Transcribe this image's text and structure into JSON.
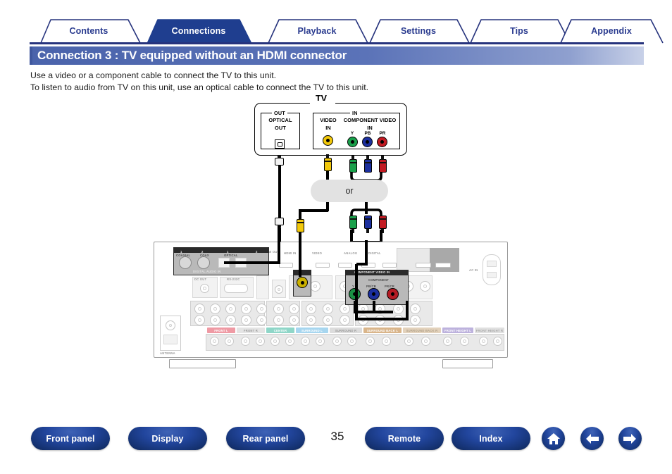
{
  "tabs": [
    {
      "label": "Contents",
      "active": false
    },
    {
      "label": "Connections",
      "active": true
    },
    {
      "label": "Playback",
      "active": false
    },
    {
      "label": "Settings",
      "active": false
    },
    {
      "label": "Tips",
      "active": false
    },
    {
      "label": "Appendix",
      "active": false
    }
  ],
  "page": {
    "title": "Connection 3 : TV equipped without an HDMI connector",
    "intro_line1": "Use a video or a component cable to connect the TV to this unit.",
    "intro_line2": "To listen to audio from TV on this unit, use an optical cable to connect the TV to this unit.",
    "number": "35"
  },
  "diagram": {
    "tv_label": "TV",
    "out_group": "OUT",
    "in_group": "IN",
    "optical_out": {
      "line1": "OPTICAL",
      "line2": "OUT"
    },
    "video_in": {
      "line1": "VIDEO",
      "line2": "IN"
    },
    "component_in": {
      "line1": "COMPONENT VIDEO",
      "line2": "IN"
    },
    "component_pins": [
      {
        "label": "Y",
        "color": "#18a04a"
      },
      {
        "label": "PB",
        "color": "#1b2f9e"
      },
      {
        "label": "PR",
        "color": "#c21a22"
      }
    ],
    "video_pin_color": "#f2c80a",
    "or_label": "or",
    "receiver": {
      "speaker_labels": [
        {
          "text": "FRONT L",
          "color": "#ef9aa4"
        },
        {
          "text": "FRONT R",
          "color": "#e4e4e4"
        },
        {
          "text": "CENTER",
          "color": "#8fd6c8"
        },
        {
          "text": "SURROUND L",
          "color": "#a7d6ef"
        },
        {
          "text": "SURROUND R",
          "color": "#dcdcdc"
        },
        {
          "text": "SURROUND BACK L",
          "color": "#d9b58a"
        },
        {
          "text": "SURROUND BACK R",
          "color": "#e3d2bc"
        },
        {
          "text": "FRONT HEIGHT L",
          "color": "#bdb2dd"
        },
        {
          "text": "FRONT HEIGHT R",
          "color": "#e0e0e0"
        }
      ]
    }
  },
  "bottom_nav": {
    "buttons": [
      {
        "label": "Front panel"
      },
      {
        "label": "Display"
      },
      {
        "label": "Rear panel"
      },
      {
        "label": "Remote"
      },
      {
        "label": "Index"
      }
    ],
    "icons": [
      {
        "name": "home-icon"
      },
      {
        "name": "arrow-left-icon"
      },
      {
        "name": "arrow-right-icon"
      }
    ]
  },
  "colors": {
    "tab_active_bg": "#1f3e8f",
    "tab_text": "#2a3b8f",
    "title_bar": "#4a63ab",
    "rule": "#26337d"
  }
}
